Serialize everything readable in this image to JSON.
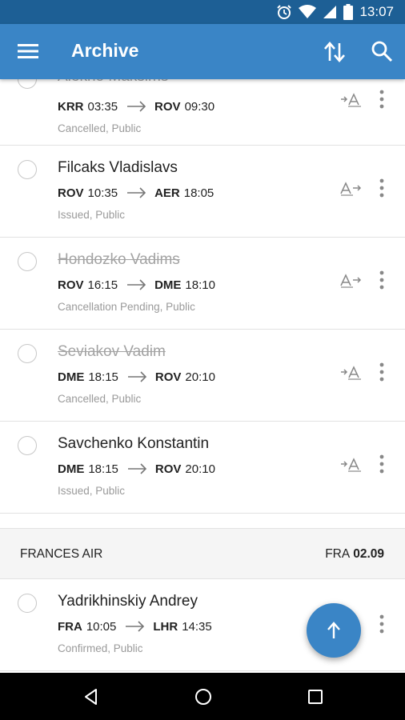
{
  "status_bar": {
    "time": "13:07",
    "icons": [
      "alarm-icon",
      "wifi-icon",
      "cell-signal-icon",
      "battery-icon"
    ]
  },
  "app_bar": {
    "title": "Archive",
    "icons": [
      "menu-icon",
      "sort-icon",
      "search-icon"
    ]
  },
  "bookings": [
    {
      "name": "Alekno Maksims",
      "from_code": "KRR",
      "from_time": "03:35",
      "to_code": "ROV",
      "to_time": "09:30",
      "status": "Cancelled, Public",
      "faded": true
    },
    {
      "name": "Filcaks Vladislavs",
      "from_code": "ROV",
      "from_time": "10:35",
      "to_code": "AER",
      "to_time": "18:05",
      "status": "Issued, Public",
      "faded": false
    },
    {
      "name": "Hondozko Vadims",
      "from_code": "ROV",
      "from_time": "16:15",
      "to_code": "DME",
      "to_time": "18:10",
      "status": "Cancellation Pending, Public",
      "faded": true
    },
    {
      "name": "Seviakov Vadim",
      "from_code": "DME",
      "from_time": "18:15",
      "to_code": "ROV",
      "to_time": "20:10",
      "status": "Cancelled, Public",
      "faded": true
    },
    {
      "name": "Savchenko Konstantin",
      "from_code": "DME",
      "from_time": "18:15",
      "to_code": "ROV",
      "to_time": "20:10",
      "status": "Issued, Public",
      "faded": false
    }
  ],
  "section": {
    "airline": "FRANCES AIR",
    "airport": "FRA",
    "date": "02.09"
  },
  "section_bookings": [
    {
      "name": "Yadrikhinskiy Andrey",
      "from_code": "FRA",
      "from_time": "10:05",
      "to_code": "LHR",
      "to_time": "14:35",
      "status": "Confirmed, Public",
      "faded": false
    }
  ],
  "colors": {
    "primary": "#3a85c6",
    "status_bar": "#1d5f95",
    "faded_text": "#a3a3a3",
    "secondary_text": "#9a9a9a"
  },
  "fab": {
    "icon": "arrow-up-icon"
  },
  "nav_bar": {
    "icons": [
      "back-icon",
      "home-icon",
      "recents-icon"
    ]
  }
}
